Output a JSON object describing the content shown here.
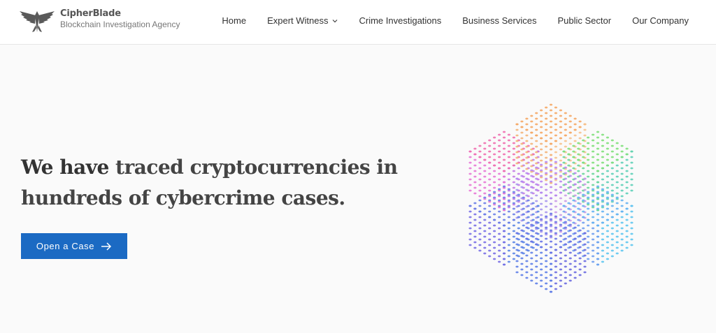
{
  "brand": {
    "name": "CipherBlade",
    "tagline": "Blockchain Investigation Agency",
    "logo_icon": "phoenix-logo-icon"
  },
  "nav": {
    "items": [
      {
        "label": "Home"
      },
      {
        "label": "Expert Witness",
        "has_dropdown": true
      },
      {
        "label": "Crime Investigations"
      },
      {
        "label": "Business Services"
      },
      {
        "label": "Public Sector"
      },
      {
        "label": "Our Company"
      }
    ]
  },
  "hero": {
    "title_strong": "We have",
    "title_rest": " traced cryptocurrencies in hundreds of cybercrime cases.",
    "cta_label": "Open a Case",
    "cta_icon": "arrow-right-icon"
  },
  "colors": {
    "accent": "#1b6ac3",
    "header_bg": "#ffffff",
    "page_bg": "#fafafa"
  }
}
